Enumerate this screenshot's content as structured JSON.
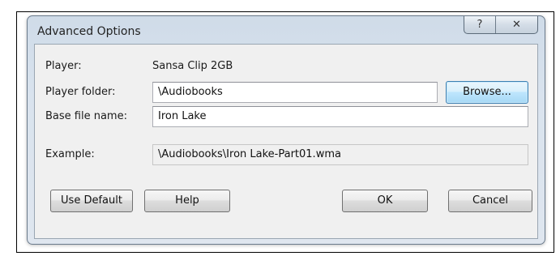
{
  "window": {
    "title": "Advanced Options",
    "help_icon": "question-mark-icon",
    "close_icon": "close-x-icon",
    "help_glyph": "?",
    "close_glyph": "✕"
  },
  "form": {
    "player_label": "Player:",
    "player_value": "Sansa Clip 2GB",
    "folder_label": "Player folder:",
    "folder_value": "\\Audiobooks",
    "browse_label": "Browse...",
    "basename_label": "Base file name:",
    "basename_value": "Iron Lake",
    "example_label": "Example:",
    "example_value": "\\Audiobooks\\Iron Lake-Part01.wma"
  },
  "buttons": {
    "use_default": "Use Default",
    "help": "Help",
    "ok": "OK",
    "cancel": "Cancel"
  },
  "colors": {
    "title_gradient_top": "#cfdbe8",
    "client_background": "#f0f0f0",
    "focused_button_border": "#3c7fb1"
  }
}
